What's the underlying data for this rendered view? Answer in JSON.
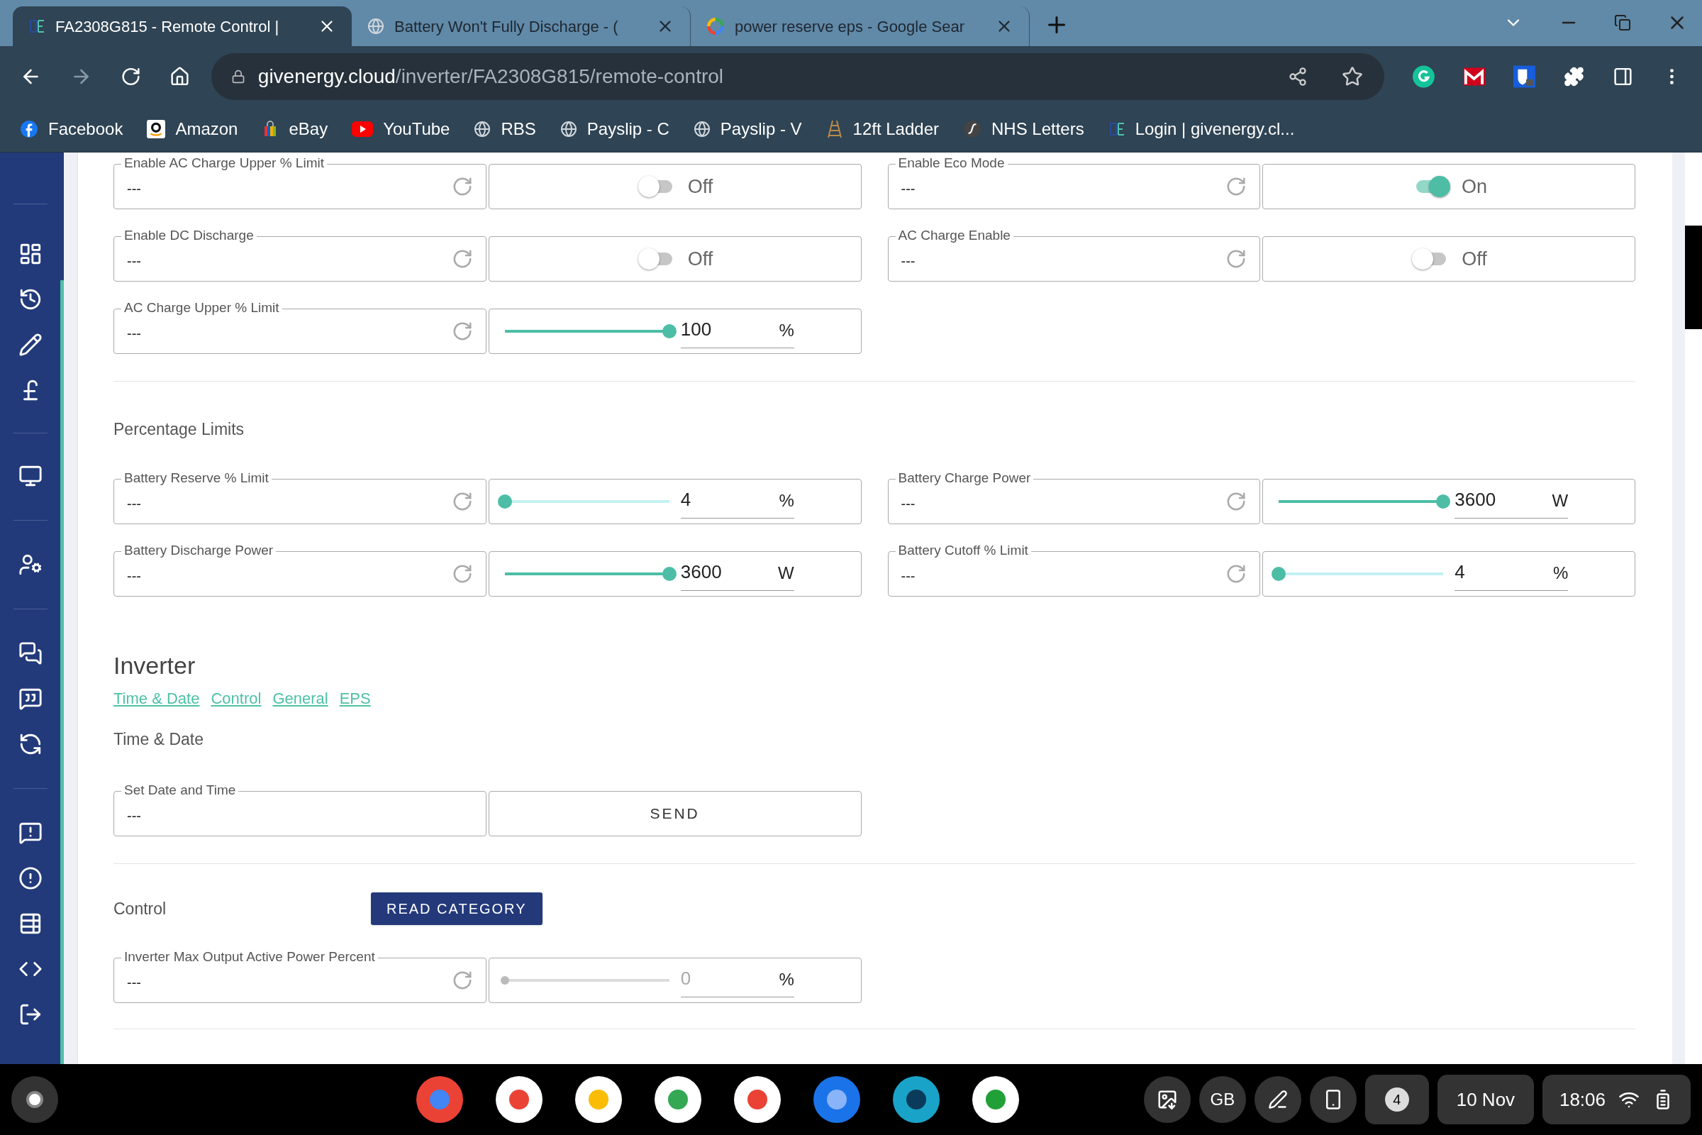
{
  "browser": {
    "tabs": [
      {
        "title": "FA2308G815 - Remote Control |",
        "selected": true
      },
      {
        "title": "Battery Won't Fully Discharge - (",
        "selected": false
      },
      {
        "title": "power reserve eps - Google Sear",
        "selected": false
      }
    ],
    "address": {
      "domain": "givenergy.cloud",
      "path": "/inverter/FA2308G815/remote-control"
    },
    "bookmarks": [
      "Facebook",
      "Amazon",
      "eBay",
      "YouTube",
      "RBS",
      "Payslip - C",
      "Payslip - V",
      "12ft Ladder",
      "NHS Letters",
      "Login | givenergy.cl..."
    ]
  },
  "top_fields": [
    {
      "label": "Enable AC Charge Upper % Limit",
      "value": "---",
      "control": {
        "kind": "toggle",
        "on": false,
        "text": "Off"
      }
    },
    {
      "label": "Enable Eco Mode",
      "value": "---",
      "control": {
        "kind": "toggle",
        "on": true,
        "text": "On"
      }
    },
    {
      "label": "Enable DC Discharge",
      "value": "---",
      "control": {
        "kind": "toggle",
        "on": false,
        "text": "Off"
      }
    },
    {
      "label": "AC Charge Enable",
      "value": "---",
      "control": {
        "kind": "toggle",
        "on": false,
        "text": "Off"
      }
    },
    {
      "label": "AC Charge Upper % Limit",
      "value": "---",
      "control": {
        "kind": "slider",
        "level": 1,
        "value": "100",
        "unit": "%",
        "disabled": false
      }
    }
  ],
  "percentage_limits": {
    "heading": "Percentage Limits",
    "fields": [
      {
        "label": "Battery Reserve % Limit",
        "value": "---",
        "control": {
          "kind": "slider",
          "level": 0,
          "value": "4",
          "unit": "%",
          "disabled": false
        }
      },
      {
        "label": "Battery Charge Power",
        "value": "---",
        "control": {
          "kind": "slider",
          "level": 1,
          "value": "3600",
          "unit": "W",
          "disabled": false
        }
      },
      {
        "label": "Battery Discharge Power",
        "value": "---",
        "control": {
          "kind": "slider",
          "level": 1,
          "value": "3600",
          "unit": "W",
          "disabled": false
        }
      },
      {
        "label": "Battery Cutoff % Limit",
        "value": "---",
        "control": {
          "kind": "slider",
          "level": 0,
          "value": "4",
          "unit": "%",
          "disabled": false
        }
      }
    ]
  },
  "inverter": {
    "heading": "Inverter",
    "links": [
      "Time & Date",
      "Control",
      "General",
      "EPS"
    ],
    "time_date": {
      "heading": "Time & Date",
      "fields": [
        {
          "label": "Set Date and Time",
          "value": "---",
          "control": {
            "kind": "button",
            "text": "SEND"
          }
        }
      ]
    },
    "control": {
      "heading": "Control",
      "button": "READ CATEGORY",
      "fields": [
        {
          "label": "Inverter Max Output Active Power Percent",
          "value": "---",
          "control": {
            "kind": "slider",
            "level": 0,
            "value": "0",
            "unit": "%",
            "disabled": true
          }
        }
      ]
    }
  },
  "taskbar": {
    "keyboard": "GB",
    "notifications": "4",
    "date": "10 Nov",
    "time": "18:06"
  }
}
